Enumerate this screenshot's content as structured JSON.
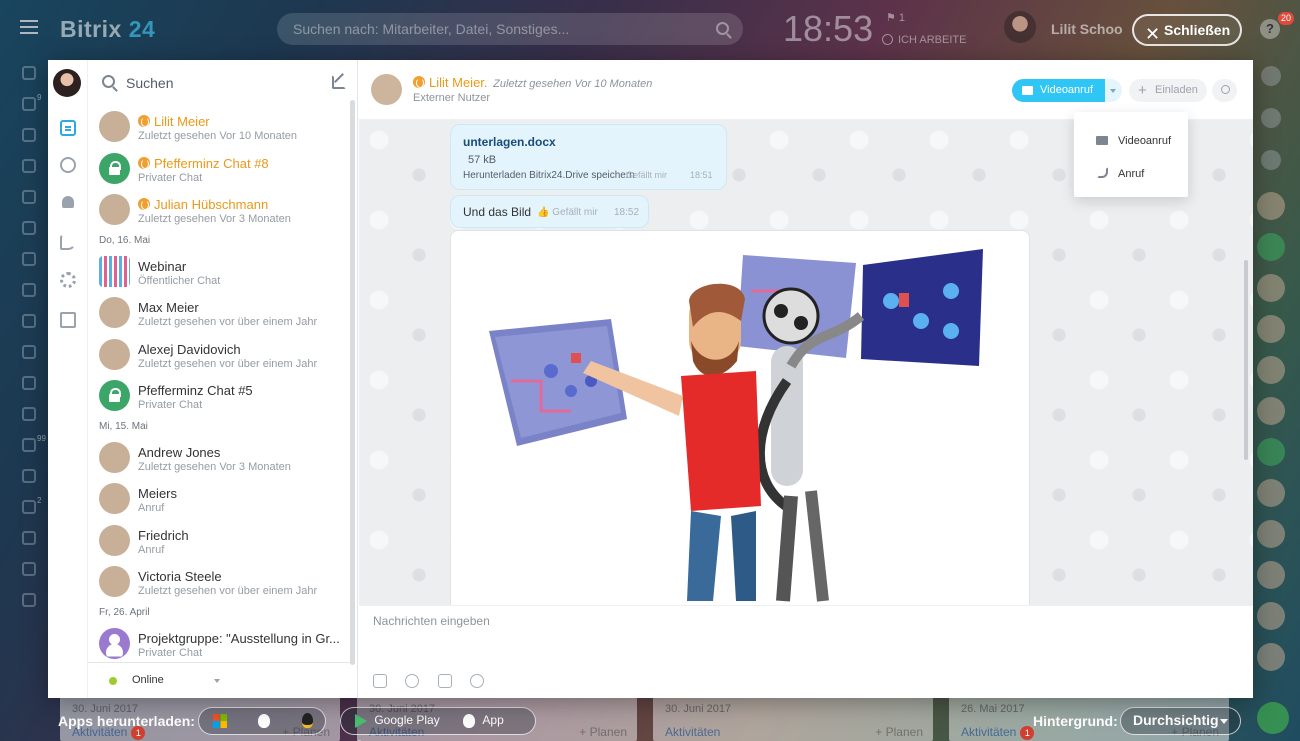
{
  "app": {
    "logo_text": "Bitrix",
    "logo_number": "24",
    "search_placeholder": "Suchen nach: Mitarbeiter, Datei, Sonstiges...",
    "clock": "18:53",
    "flag_count": "1",
    "work_status": "ICH ARBEITE",
    "user_name": "Lilit Schoo",
    "close_label": "Schließen",
    "help_badge": "20",
    "left_nav_badges": {
      "task": "9",
      "feed": "99",
      "done": "2"
    }
  },
  "messenger": {
    "search_label": "Suchen",
    "chats": [
      {
        "type": "item",
        "name": "Lilit Meier",
        "sub": "Zuletzt gesehen Vor 10 Monaten",
        "external": true,
        "avatar": "person"
      },
      {
        "type": "item",
        "name": "Pfefferminz Chat #8",
        "sub": "Privater Chat",
        "external": true,
        "avatar": "lock"
      },
      {
        "type": "item",
        "name": "Julian Hübschmann",
        "sub": "Zuletzt gesehen Vor 3 Monaten",
        "external": true,
        "avatar": "person"
      },
      {
        "type": "sep",
        "label": "Do, 16. Mai"
      },
      {
        "type": "item",
        "name": "Webinar",
        "sub": "Öffentlicher Chat",
        "external": false,
        "avatar": "webinar"
      },
      {
        "type": "item",
        "name": "Max Meier",
        "sub": "Zuletzt gesehen vor über einem Jahr",
        "external": false,
        "avatar": "person"
      },
      {
        "type": "item",
        "name": "Alexej Davidovich",
        "sub": "Zuletzt gesehen vor über einem Jahr",
        "external": false,
        "avatar": "person"
      },
      {
        "type": "item",
        "name": "Pfefferminz Chat #5",
        "sub": "Privater Chat",
        "external": false,
        "avatar": "lock"
      },
      {
        "type": "sep",
        "label": "Mi, 15. Mai"
      },
      {
        "type": "item",
        "name": "Andrew Jones",
        "sub": "Zuletzt gesehen Vor 3 Monaten",
        "external": false,
        "avatar": "person"
      },
      {
        "type": "item",
        "name": "Meiers",
        "sub": "Anruf",
        "external": false,
        "avatar": "person"
      },
      {
        "type": "item",
        "name": "Friedrich",
        "sub": "Anruf",
        "external": false,
        "avatar": "person"
      },
      {
        "type": "item",
        "name": "Victoria Steele",
        "sub": "Zuletzt gesehen vor über einem Jahr",
        "external": false,
        "avatar": "person"
      },
      {
        "type": "sep",
        "label": "Fr, 26. April"
      },
      {
        "type": "item",
        "name": "Projektgruppe: \"Ausstellung in Gr...",
        "sub": "Privater Chat",
        "external": false,
        "avatar": "group"
      }
    ],
    "status": "Online",
    "header": {
      "name": "Lilit Meier.",
      "last_seen": "Zuletzt gesehen Vor 10 Monaten",
      "subtitle": "Externer Nutzer",
      "video_call": "Videoanruf",
      "invite": "Einladen"
    },
    "dropdown": {
      "video": "Videoanruf",
      "call": "Anruf"
    },
    "messages": {
      "file_name": "unterlagen.docx",
      "file_size": "57 kB",
      "file_actions": "Herunterladen   Bitrix24.Drive speichern",
      "file_like": "Gefällt mir",
      "file_time": "18:51",
      "text": "Und das Bild",
      "text_like": "Gefällt mir",
      "text_time": "18:52"
    },
    "input_placeholder": "Nachrichten eingeben"
  },
  "bottom": {
    "apps_label": "Apps herunterladen:",
    "google_play": "Google Play",
    "app_store": "App Store",
    "background_label": "Hintergrund:",
    "background_value": "Durchsichtig",
    "cards": [
      {
        "date": "30. Juni 2017",
        "activities": "Aktivitäten",
        "count": "1",
        "plan": "+ Planen"
      },
      {
        "date": "30. Juni 2017",
        "activities": "Aktivitäten",
        "count": "",
        "plan": "+ Planen"
      },
      {
        "date": "30. Juni 2017",
        "activities": "Aktivitäten",
        "count": "",
        "plan": "+ Planen"
      },
      {
        "date": "26. Mai 2017",
        "activities": "Aktivitäten",
        "count": "1",
        "plan": "+ Planen"
      }
    ]
  },
  "colors": {
    "accent": "#2fc6f6",
    "external_user": "#e89a1a",
    "online": "#9ccc30",
    "private_chat": "#3ca568"
  }
}
